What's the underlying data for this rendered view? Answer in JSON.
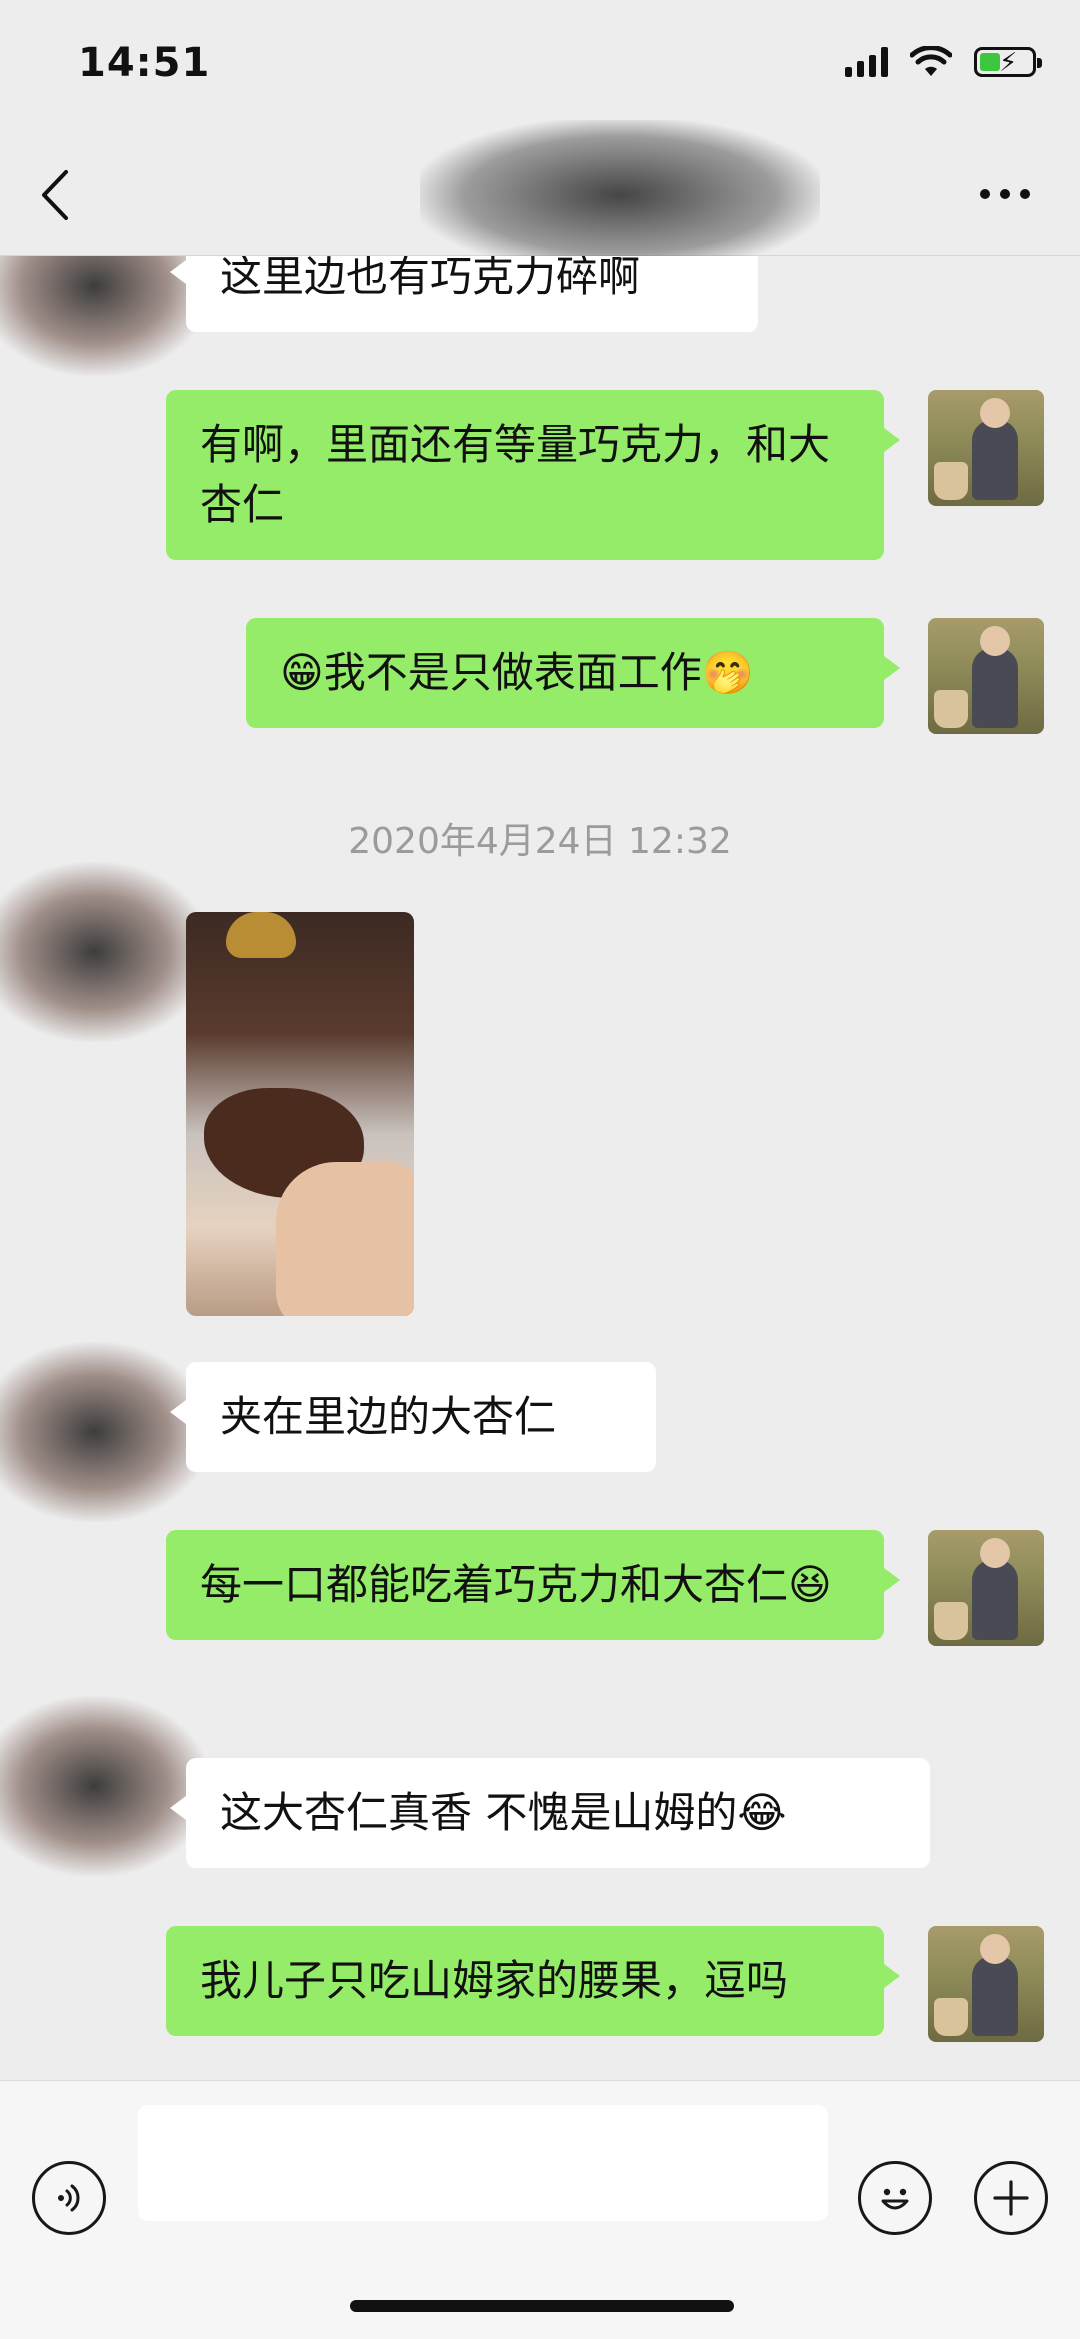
{
  "status_bar": {
    "time": "14:51"
  },
  "nav": {
    "title": ""
  },
  "messages": [
    {
      "id": "m1",
      "side": "them",
      "text": "这里边也有巧克力碎啊"
    },
    {
      "id": "m2",
      "side": "me",
      "text": "有啊，里面还有等量巧克力，和大杏仁"
    },
    {
      "id": "m3",
      "side": "me",
      "text": "我不是只做表面工作",
      "emoji_before": "😁",
      "emoji_after": "🤭"
    },
    {
      "id": "ts",
      "type": "timestamp",
      "text": "2020年4月24日 12:32"
    },
    {
      "id": "m4",
      "side": "them",
      "type": "image",
      "image_desc": "photo"
    },
    {
      "id": "m5",
      "side": "them",
      "text": "夹在里边的大杏仁"
    },
    {
      "id": "m6",
      "side": "me",
      "text": "每一口都能吃着巧克力和大杏仁",
      "emoji_after": "😆"
    },
    {
      "id": "m7",
      "side": "them",
      "text": "这大杏仁真香 不愧是山姆的",
      "emoji_after": "😂"
    },
    {
      "id": "m8",
      "side": "me",
      "text": "我儿子只吃山姆家的腰果，逗吗"
    }
  ],
  "input": {
    "value": "",
    "placeholder": ""
  },
  "icons": [
    "back-icon",
    "more-icon",
    "voice-icon",
    "emoji-icon",
    "plus-icon",
    "wifi-icon",
    "signal-icon",
    "battery-icon"
  ]
}
